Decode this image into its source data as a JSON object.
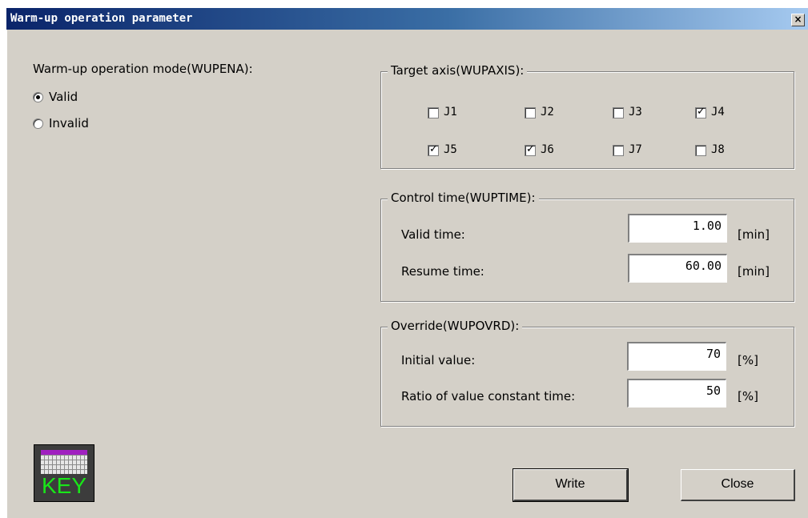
{
  "window": {
    "title": "Warm-up operation parameter",
    "close_glyph": "×"
  },
  "mode": {
    "label": "Warm-up operation mode(WUPENA):",
    "options": [
      {
        "label": "Valid",
        "selected": true
      },
      {
        "label": "Invalid",
        "selected": false
      }
    ]
  },
  "target_axis": {
    "label": "Target axis(WUPAXIS):",
    "axes": [
      {
        "label": "J1",
        "checked": false
      },
      {
        "label": "J2",
        "checked": false
      },
      {
        "label": "J3",
        "checked": false
      },
      {
        "label": "J4",
        "checked": true
      },
      {
        "label": "J5",
        "checked": true
      },
      {
        "label": "J6",
        "checked": true
      },
      {
        "label": "J7",
        "checked": false
      },
      {
        "label": "J8",
        "checked": false
      }
    ]
  },
  "control_time": {
    "label": "Control time(WUPTIME):",
    "valid_time": {
      "label": "Valid time:",
      "value": "1.00",
      "unit": "[min]"
    },
    "resume_time": {
      "label": "Resume time:",
      "value": "60.00",
      "unit": "[min]"
    }
  },
  "override": {
    "label": "Override(WUPOVRD):",
    "initial_value": {
      "label": "Initial value:",
      "value": "70",
      "unit": "[%]"
    },
    "ratio": {
      "label": "Ratio of value constant time:",
      "value": "50",
      "unit": "[%]"
    }
  },
  "buttons": {
    "write": "Write",
    "close": "Close"
  },
  "key_icon": {
    "label": "KEY",
    "icon": "keyboard-icon"
  },
  "colors": {
    "dialog_bg": "#d4d0c8",
    "title_start": "#0a246a",
    "title_end": "#a6caf0",
    "key_text": "#19e619"
  }
}
